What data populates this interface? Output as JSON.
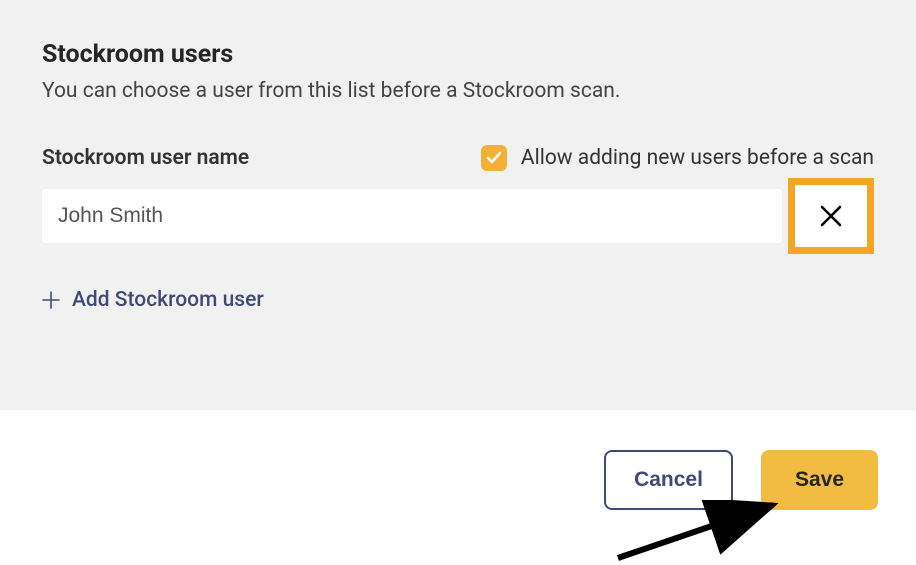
{
  "header": {
    "title": "Stockroom users",
    "subtitle": "You can choose a user from this list before a Stockroom scan."
  },
  "form": {
    "name_label": "Stockroom user name",
    "allow_new_label": "Allow adding new users before a scan",
    "allow_new_checked": true,
    "user_value": "John Smith",
    "add_label": "Add Stockroom user"
  },
  "footer": {
    "cancel_label": "Cancel",
    "save_label": "Save"
  }
}
